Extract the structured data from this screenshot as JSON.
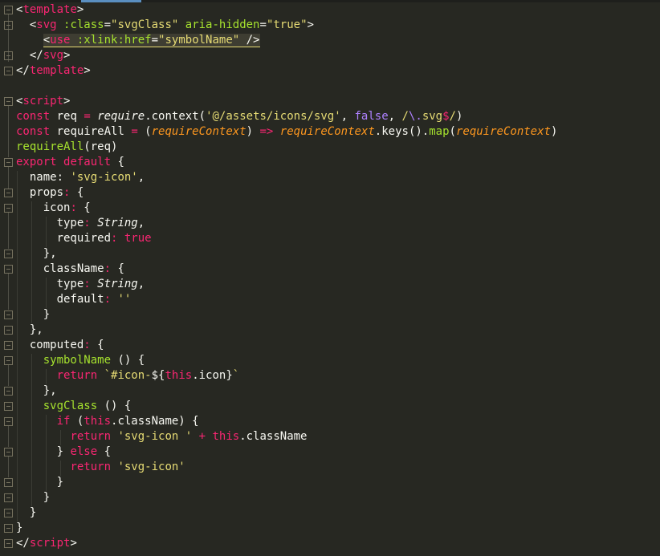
{
  "editor": {
    "theme_colors": {
      "background": "#272822",
      "tag": "#f92672",
      "attribute": "#a6e22e",
      "string": "#e6db74",
      "keyword": "#f92672",
      "parameter": "#fd971f",
      "type": "#66d9ef",
      "constant": "#ae81ff",
      "text": "#f8f8f2"
    },
    "active_tab_indicator_color": "#5a8fc0"
  },
  "code": {
    "l1": {
      "open": "<",
      "tag": "template",
      "close": ">"
    },
    "l2": {
      "indent": "  ",
      "open": "<",
      "tag": "svg",
      "attr1": " :class",
      "eq1": "=",
      "val1": "\"svgClass\"",
      "attr2": " aria-hidden",
      "eq2": "=",
      "val2": "\"true\"",
      "close": ">"
    },
    "l3": {
      "indent": "    ",
      "open": "<",
      "tag": "use",
      "attr1": " :xlink:href",
      "eq1": "=",
      "val1": "\"symbolName\"",
      "close": " />"
    },
    "l4": {
      "indent": "  ",
      "open": "</",
      "tag": "svg",
      "close": ">"
    },
    "l5": {
      "open": "</",
      "tag": "template",
      "close": ">"
    },
    "l7": {
      "open": "<",
      "tag": "script",
      "close": ">"
    },
    "l8": {
      "kw": "const",
      "name": " req ",
      "op": "=",
      "sp": " ",
      "fn": "require",
      "rest1": ".context(",
      "s1": "'@/assets/icons/svg'",
      "comma": ", ",
      "bool": "false",
      "comma2": ", ",
      "re1": "/",
      "re_esc": "\\.",
      "re2": "svg",
      "re_dollar": "$",
      "re3": "/",
      "end": ")"
    },
    "l9": {
      "kw": "const",
      "name": " requireAll ",
      "op": "=",
      "p1": " (",
      "param": "requireContext",
      "p2": ") ",
      "arrow": "=>",
      "sp": " ",
      "param2": "requireContext",
      "rest": ".keys().",
      "fn": "map",
      "p3": "(",
      "param3": "requireContext",
      "p4": ")"
    },
    "l10": {
      "fn": "requireAll",
      "rest": "(req)"
    },
    "l11": {
      "kw1": "export",
      "sp": " ",
      "kw2": "default",
      "rest": " {"
    },
    "l12": {
      "indent": "  ",
      "key": "name",
      "colon": ": ",
      "str": "'svg-icon'",
      "rest": ","
    },
    "l13": {
      "indent": "  ",
      "key": "props",
      "colon": ": ",
      "rest": "{"
    },
    "l14": {
      "indent": "    ",
      "key": "icon",
      "colon": ": ",
      "rest": "{"
    },
    "l15": {
      "indent": "      ",
      "key": "type",
      "colon": ": ",
      "type": "String",
      "rest": ","
    },
    "l16": {
      "indent": "      ",
      "key": "required",
      "colon": ": ",
      "kw": "true"
    },
    "l17": {
      "indent": "    ",
      "rest": "},"
    },
    "l18": {
      "indent": "    ",
      "key": "className",
      "colon": ": ",
      "rest": "{"
    },
    "l19": {
      "indent": "      ",
      "key": "type",
      "colon": ": ",
      "type": "String",
      "rest": ","
    },
    "l20": {
      "indent": "      ",
      "key": "default",
      "colon": ": ",
      "str": "''"
    },
    "l21": {
      "indent": "    ",
      "rest": "}"
    },
    "l22": {
      "indent": "  ",
      "rest": "},"
    },
    "l23": {
      "indent": "  ",
      "key": "computed",
      "colon": ": ",
      "rest": "{"
    },
    "l24": {
      "indent": "    ",
      "fn": "symbolName",
      "rest": " () {"
    },
    "l25": {
      "indent": "      ",
      "kw": "return",
      "sp": " ",
      "t1": "`#icon-",
      "i1": "${",
      "this": "this",
      "i2": ".icon",
      "i3": "}",
      "t2": "`"
    },
    "l26": {
      "indent": "    ",
      "rest": "},"
    },
    "l27": {
      "indent": "    ",
      "fn": "svgClass",
      "rest": " () {"
    },
    "l28": {
      "indent": "      ",
      "kw": "if",
      "p1": " (",
      "this": "this",
      "rest": ".className) {"
    },
    "l29": {
      "indent": "        ",
      "kw": "return",
      "sp": " ",
      "str": "'svg-icon '",
      "op_sp": " ",
      "op": "+",
      "sp2": " ",
      "this": "this",
      "rest": ".className"
    },
    "l30": {
      "indent": "      ",
      "p1": "} ",
      "kw": "else",
      "rest": " {"
    },
    "l31": {
      "indent": "        ",
      "kw": "return",
      "sp": " ",
      "str": "'svg-icon'"
    },
    "l32": {
      "indent": "      ",
      "rest": "}"
    },
    "l33": {
      "indent": "    ",
      "rest": "}"
    },
    "l34": {
      "indent": "  ",
      "rest": "}"
    },
    "l35": {
      "rest": "}"
    },
    "l36": {
      "open": "</",
      "tag": "script",
      "close": ">"
    }
  }
}
